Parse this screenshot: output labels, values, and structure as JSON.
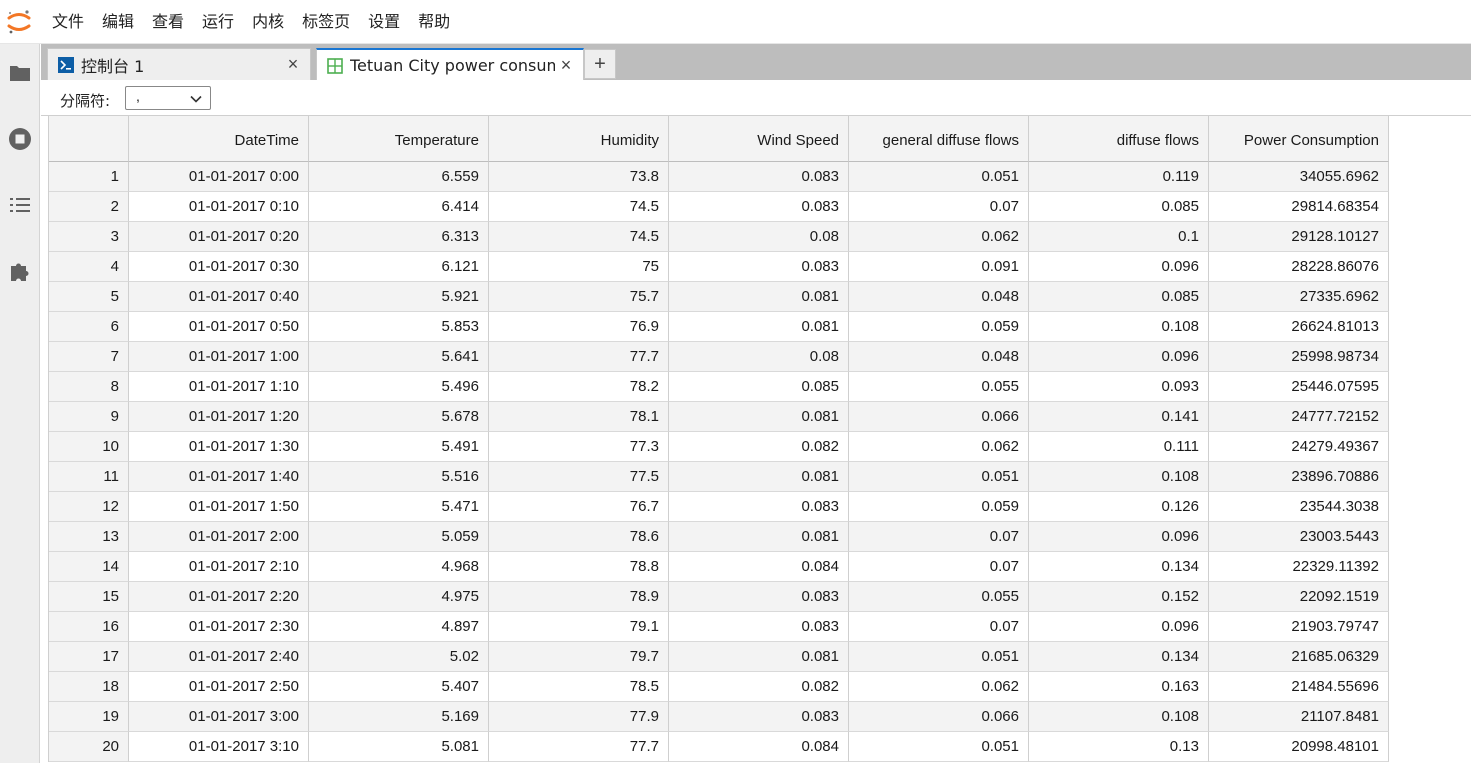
{
  "menu": [
    "文件",
    "编辑",
    "查看",
    "运行",
    "内核",
    "标签页",
    "设置",
    "帮助"
  ],
  "sidebar_icons": [
    "folder-icon",
    "stop-circle-icon",
    "list-icon",
    "puzzle-icon"
  ],
  "tabs": [
    {
      "label": "控制台 1",
      "icon": "console-icon",
      "close": "×"
    },
    {
      "label": "Tetuan City power consumption.csv",
      "icon": "table-icon",
      "close": "×"
    }
  ],
  "add_tab": "+",
  "toolbar": {
    "separator_label": "分隔符:",
    "separator_value": ","
  },
  "table": {
    "columns": [
      "DateTime",
      "Temperature",
      "Humidity",
      "Wind Speed",
      "general diffuse flows",
      "diffuse flows",
      "Power Consumption"
    ],
    "rows": [
      [
        "1",
        "01-01-2017 0:00",
        "6.559",
        "73.8",
        "0.083",
        "0.051",
        "0.119",
        "34055.6962"
      ],
      [
        "2",
        "01-01-2017 0:10",
        "6.414",
        "74.5",
        "0.083",
        "0.07",
        "0.085",
        "29814.68354"
      ],
      [
        "3",
        "01-01-2017 0:20",
        "6.313",
        "74.5",
        "0.08",
        "0.062",
        "0.1",
        "29128.10127"
      ],
      [
        "4",
        "01-01-2017 0:30",
        "6.121",
        "75",
        "0.083",
        "0.091",
        "0.096",
        "28228.86076"
      ],
      [
        "5",
        "01-01-2017 0:40",
        "5.921",
        "75.7",
        "0.081",
        "0.048",
        "0.085",
        "27335.6962"
      ],
      [
        "6",
        "01-01-2017 0:50",
        "5.853",
        "76.9",
        "0.081",
        "0.059",
        "0.108",
        "26624.81013"
      ],
      [
        "7",
        "01-01-2017 1:00",
        "5.641",
        "77.7",
        "0.08",
        "0.048",
        "0.096",
        "25998.98734"
      ],
      [
        "8",
        "01-01-2017 1:10",
        "5.496",
        "78.2",
        "0.085",
        "0.055",
        "0.093",
        "25446.07595"
      ],
      [
        "9",
        "01-01-2017 1:20",
        "5.678",
        "78.1",
        "0.081",
        "0.066",
        "0.141",
        "24777.72152"
      ],
      [
        "10",
        "01-01-2017 1:30",
        "5.491",
        "77.3",
        "0.082",
        "0.062",
        "0.111",
        "24279.49367"
      ],
      [
        "11",
        "01-01-2017 1:40",
        "5.516",
        "77.5",
        "0.081",
        "0.051",
        "0.108",
        "23896.70886"
      ],
      [
        "12",
        "01-01-2017 1:50",
        "5.471",
        "76.7",
        "0.083",
        "0.059",
        "0.126",
        "23544.3038"
      ],
      [
        "13",
        "01-01-2017 2:00",
        "5.059",
        "78.6",
        "0.081",
        "0.07",
        "0.096",
        "23003.5443"
      ],
      [
        "14",
        "01-01-2017 2:10",
        "4.968",
        "78.8",
        "0.084",
        "0.07",
        "0.134",
        "22329.11392"
      ],
      [
        "15",
        "01-01-2017 2:20",
        "4.975",
        "78.9",
        "0.083",
        "0.055",
        "0.152",
        "22092.1519"
      ],
      [
        "16",
        "01-01-2017 2:30",
        "4.897",
        "79.1",
        "0.083",
        "0.07",
        "0.096",
        "21903.79747"
      ],
      [
        "17",
        "01-01-2017 2:40",
        "5.02",
        "79.7",
        "0.081",
        "0.051",
        "0.134",
        "21685.06329"
      ],
      [
        "18",
        "01-01-2017 2:50",
        "5.407",
        "78.5",
        "0.082",
        "0.062",
        "0.163",
        "21484.55696"
      ],
      [
        "19",
        "01-01-2017 3:00",
        "5.169",
        "77.9",
        "0.083",
        "0.066",
        "0.108",
        "21107.8481"
      ],
      [
        "20",
        "01-01-2017 3:10",
        "5.081",
        "77.7",
        "0.084",
        "0.051",
        "0.13",
        "20998.48101"
      ]
    ]
  },
  "colors": {
    "accent": "#1976d2",
    "logo": "#f37726",
    "grid_alt": "#f3f3f3"
  }
}
